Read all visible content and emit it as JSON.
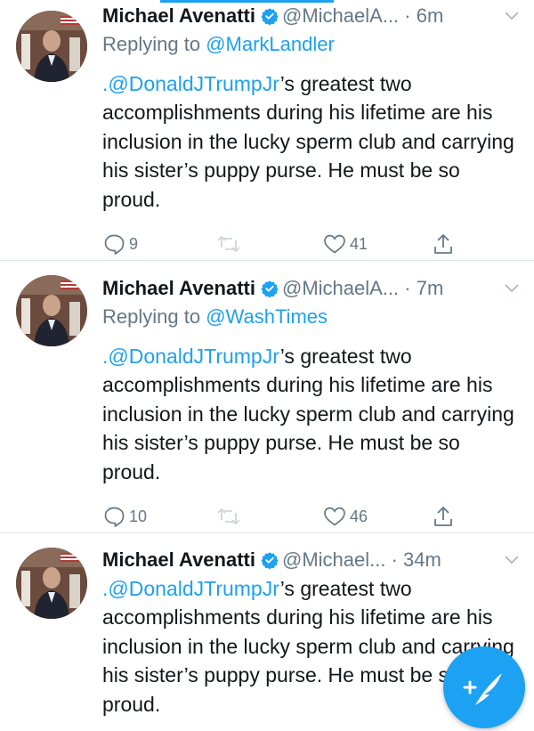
{
  "colors": {
    "accent": "#1da1f2",
    "muted": "#657786",
    "text": "#14171a",
    "divider": "#e1e8ed"
  },
  "tweets": [
    {
      "name": "Michael Avenatti",
      "handle": "@MichaelA...",
      "time": "· 6m",
      "reply_prefix": "Replying to ",
      "reply_to": "@MarkLandler",
      "mention": ".@DonaldJTrumpJr",
      "text": "’s greatest two accomplishments during his lifetime are his inclusion in the lucky sperm club and carrying his sister’s puppy purse. He must be so proud.",
      "replies": "9",
      "retweets": "",
      "likes": "41"
    },
    {
      "name": "Michael Avenatti",
      "handle": "@MichaelA...",
      "time": "· 7m",
      "reply_prefix": "Replying to ",
      "reply_to": "@WashTimes",
      "mention": ".@DonaldJTrumpJr",
      "text": "’s greatest two accomplishments during his lifetime are his inclusion in the lucky sperm club and carrying his sister’s puppy purse. He must be so proud.",
      "replies": "10",
      "retweets": "",
      "likes": "46"
    },
    {
      "name": "Michael Avenatti",
      "handle": "@Michael...",
      "time": "· 34m",
      "mention": ".@DonaldJTrumpJr",
      "text": "’s greatest two accomplishments during his lifetime are his inclusion in the lucky sperm club and carrying his sister’s puppy purse. He must be so proud."
    }
  ],
  "icons": {
    "verified": "verified-badge-icon",
    "caret": "chevron-down-icon",
    "reply": "reply-icon",
    "retweet": "retweet-icon",
    "like": "heart-icon",
    "share": "share-icon",
    "compose": "compose-tweet-icon"
  }
}
